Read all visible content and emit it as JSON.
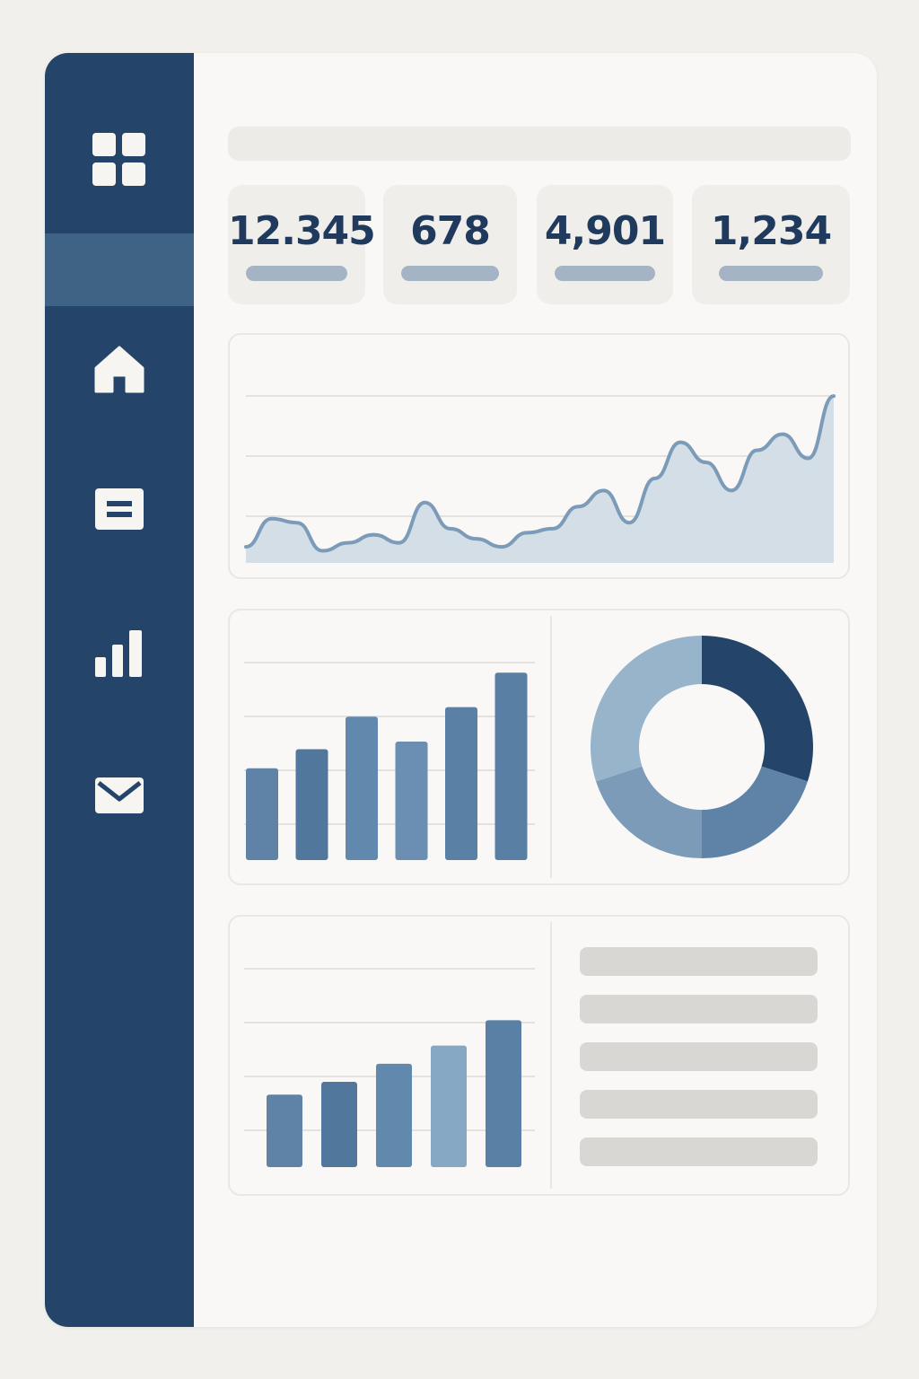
{
  "sidebar": {
    "items": [
      {
        "icon": "grid-icon",
        "active": false
      },
      {
        "icon": "active-slot",
        "active": true
      },
      {
        "icon": "home-icon",
        "active": false
      },
      {
        "icon": "document-icon",
        "active": false
      },
      {
        "icon": "bar-chart-icon",
        "active": false
      },
      {
        "icon": "mail-icon",
        "active": false
      }
    ]
  },
  "stats": [
    {
      "value": "12.345"
    },
    {
      "value": "678"
    },
    {
      "value": "4,901"
    },
    {
      "value": "1,234"
    }
  ],
  "colors": {
    "sidebar": "#244569",
    "sidebar_active": "#3f6385",
    "text_dark": "#1f3a5c",
    "line_stroke": "#7b9bb8",
    "area_fill": "#d3dee6",
    "bar": "#5e83a7",
    "bar_light": "#86a8c4",
    "donut": [
      "#244569",
      "#5e83a7",
      "#7b9bb8",
      "#97b4cb"
    ]
  },
  "chart_data": [
    {
      "type": "area",
      "x": [
        0,
        1,
        2,
        3,
        4,
        5,
        6,
        7,
        8,
        9,
        10,
        11,
        12,
        13,
        14,
        15,
        16,
        17,
        18,
        19,
        20,
        21,
        22,
        23
      ],
      "values": [
        8,
        22,
        20,
        6,
        10,
        14,
        10,
        30,
        17,
        12,
        8,
        15,
        17,
        28,
        36,
        20,
        42,
        60,
        50,
        36,
        56,
        64,
        52,
        83
      ],
      "ylim": [
        0,
        100
      ],
      "grid": true
    },
    {
      "type": "bar",
      "values": [
        48,
        58,
        75,
        62,
        80,
        98
      ],
      "ylim": [
        0,
        100
      ],
      "grid": true
    },
    {
      "type": "pie",
      "style": "donut",
      "values": [
        30,
        20,
        20,
        30
      ]
    },
    {
      "type": "bar",
      "values": [
        40,
        47,
        57,
        67,
        81
      ],
      "ylim": [
        0,
        100
      ],
      "highlight_index": 3,
      "grid": true
    }
  ]
}
